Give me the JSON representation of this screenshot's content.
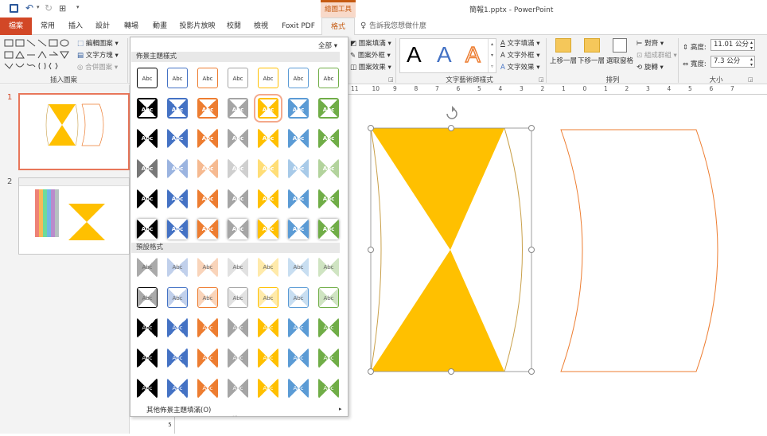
{
  "window_title": "簡報1.pptx - PowerPoint",
  "context_tab_group": "繪圖工具",
  "tabs": [
    "檔案",
    "常用",
    "插入",
    "設計",
    "轉場",
    "動畫",
    "投影片放映",
    "校閱",
    "檢視",
    "Foxit PDF",
    "格式"
  ],
  "tell_me": "告訴我您想做什麼",
  "ribbon": {
    "insert_shapes": {
      "label": "插入圖案",
      "edit_shape": "編輯圖案",
      "text_box": "文字方塊",
      "merge_shapes": "合併圖案"
    },
    "shape_styles": {
      "fill": "圖案填滿",
      "outline": "圖案外框",
      "effects": "圖案效果"
    },
    "wordart": {
      "label": "文字藝術師樣式",
      "samples": [
        "A",
        "A",
        "A"
      ],
      "text_fill": "文字填滿",
      "text_outline": "文字外框",
      "text_effects": "文字效果"
    },
    "arrange": {
      "label": "排列",
      "bring_forward": "上移一層",
      "send_backward": "下移一層",
      "selection_pane": "選取窗格",
      "align": "對齊",
      "group": "組成群組",
      "rotate": "旋轉"
    },
    "size": {
      "label": "大小",
      "height_label": "高度:",
      "height_value": "11.01 公分",
      "width_label": "寬度:",
      "width_value": "7.3 公分"
    }
  },
  "gallery": {
    "filter": "全部",
    "theme_styles_header": "佈景主題樣式",
    "preset_header": "預設格式",
    "cell_text": "Abc",
    "more_fills": "其他佈景主題填滿(O)",
    "colors": [
      "#000000",
      "#4472c4",
      "#ed7d31",
      "#a5a5a5",
      "#ffc000",
      "#5b9bd5",
      "#70ad47"
    ]
  },
  "slides": [
    {
      "number": "1"
    },
    {
      "number": "2"
    }
  ],
  "ruler_numbers": [
    "11",
    "10",
    "9",
    "8",
    "7",
    "6",
    "5",
    "4",
    "3",
    "2",
    "1",
    "0",
    "1",
    "2",
    "3",
    "4",
    "5",
    "6",
    "7"
  ],
  "colors": {
    "accent_tab": "#d24726",
    "context": "#c55a11",
    "hourglass": "#ffc000",
    "outline": "#ed7d31"
  }
}
